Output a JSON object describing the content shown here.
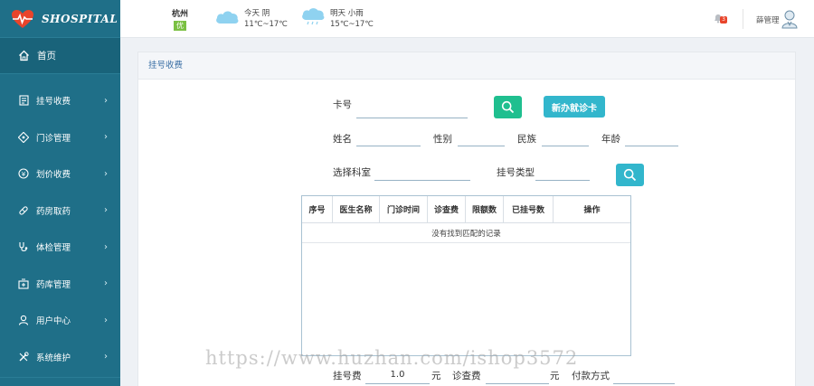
{
  "app": {
    "logo_text": "SHOSPITAL"
  },
  "sidebar": {
    "home": {
      "label": "首页",
      "icon": "home-icon"
    },
    "items": [
      {
        "label": "挂号收费",
        "icon": "register-icon"
      },
      {
        "label": "门诊管理",
        "icon": "clinic-icon"
      },
      {
        "label": "划价收费",
        "icon": "price-icon"
      },
      {
        "label": "药房取药",
        "icon": "pharmacy-icon"
      },
      {
        "label": "体检管理",
        "icon": "checkup-icon"
      },
      {
        "label": "药库管理",
        "icon": "warehouse-icon"
      },
      {
        "label": "用户中心",
        "icon": "user-icon"
      },
      {
        "label": "系统维护",
        "icon": "tools-icon"
      }
    ],
    "chevron": "›"
  },
  "header": {
    "city": "杭州",
    "air_quality": "优",
    "today": {
      "label": "今天 阴",
      "temp": "11℃~17℃"
    },
    "tomorrow": {
      "label": "明天 小雨",
      "temp": "15℃~17℃"
    },
    "notification_count": "3",
    "user_name": "薛管理"
  },
  "panel": {
    "title": "挂号收费",
    "form": {
      "card_no": "卡号",
      "new_card_button": "新办就诊卡",
      "name": "姓名",
      "gender": "性别",
      "ethnicity": "民族",
      "age": "年龄",
      "department": "选择科室",
      "reg_type": "挂号类型",
      "reg_fee": "挂号费",
      "reg_fee_value": "1.0",
      "unit_yuan": "元",
      "exam_fee": "诊查费",
      "unit_yuan2": "元",
      "payment_method": "付款方式"
    },
    "table": {
      "columns": [
        "序号",
        "医生名称",
        "门诊时间",
        "诊查费",
        "限额数",
        "已挂号数",
        "操作"
      ],
      "empty_text": "没有找到匹配的记录"
    }
  },
  "watermark": "https://www.huzhan.com/ishop3572",
  "colors": {
    "sidebar": "#1f6f88",
    "accent_green": "#1fbf8f",
    "accent_cyan": "#32b6cc",
    "badge_red": "#e8442b"
  }
}
